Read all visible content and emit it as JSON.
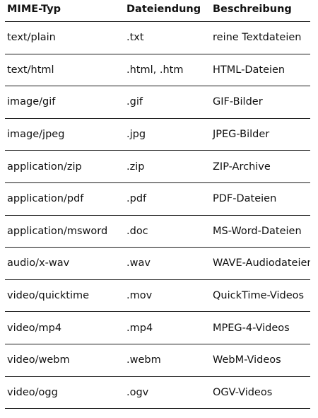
{
  "table": {
    "headers": [
      "MIME-Typ",
      "Dateiendung",
      "Beschreibung"
    ],
    "rows": [
      [
        "text/plain",
        ".txt",
        "reine Textdateien"
      ],
      [
        "text/html",
        ".html, .htm",
        "HTML-Dateien"
      ],
      [
        "image/gif",
        ".gif",
        "GIF-Bilder"
      ],
      [
        "image/jpeg",
        ".jpg",
        "JPEG-Bilder"
      ],
      [
        "application/zip",
        ".zip",
        "ZIP-Archive"
      ],
      [
        "application/pdf",
        ".pdf",
        "PDF-Dateien"
      ],
      [
        "application/msword",
        ".doc",
        "MS-Word-Dateien"
      ],
      [
        "audio/x-wav",
        ".wav",
        "WAVE-Audiodateien"
      ],
      [
        "video/quicktime",
        ".mov",
        "QuickTime-Videos"
      ],
      [
        "video/mp4",
        ".mp4",
        "MPEG-4-Videos"
      ],
      [
        "video/webm",
        ".webm",
        "WebM-Videos"
      ],
      [
        "video/ogg",
        ".ogv",
        "OGV-Videos"
      ]
    ]
  }
}
